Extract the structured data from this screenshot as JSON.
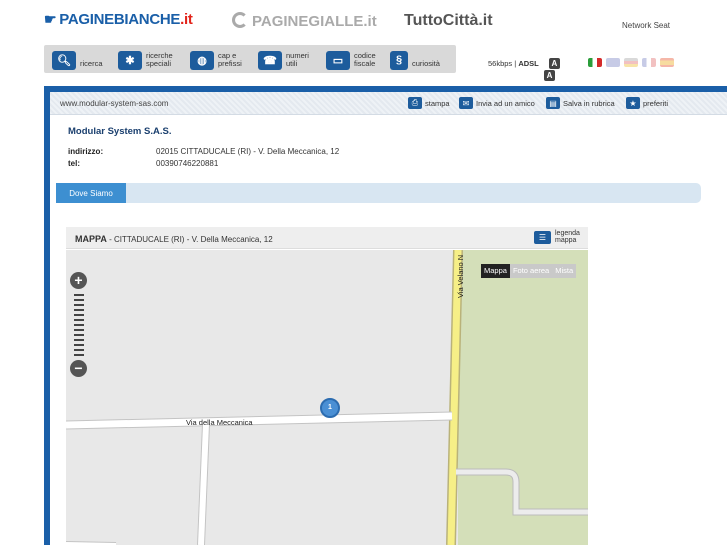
{
  "header": {
    "logo_pb": "PAGINEBIANCHE",
    "logo_pb_suffix": ".it",
    "logo_pg": "PAGINEGIALLE.it",
    "logo_tc": "TuttoCittà.it",
    "network": "Network Seat"
  },
  "toolbar": {
    "items": [
      {
        "label": "ricerca",
        "icon": "search-icon"
      },
      {
        "label": "ricerche speciali",
        "icon": "puzzle-icon"
      },
      {
        "label": "cap e prefissi",
        "icon": "globe-icon"
      },
      {
        "label": "numeri utili",
        "icon": "phone-icon"
      },
      {
        "label": "codice fiscale",
        "icon": "id-card-icon"
      },
      {
        "label": "curiosità",
        "icon": "info-icon"
      }
    ],
    "speed": "56kbps",
    "adsl": "ADSL",
    "font_small": "A",
    "font_large": "A"
  },
  "languages": [
    "it",
    "en",
    "de",
    "fr",
    "es"
  ],
  "page": {
    "url": "www.modular-system-sas.com",
    "actions": {
      "print": "stampa",
      "send": "Invia ad un amico",
      "save": "Salva in rubrica",
      "favorites": "preferiti"
    },
    "company": "Modular System S.A.S.",
    "address_label": "indirizzo:",
    "address": "02015 CITTADUCALE (RI) - V. Della Meccanica, 12",
    "tel_label": "tel:",
    "tel": "00390746220881",
    "tab": "Dove Siamo"
  },
  "map": {
    "title": "MAPPA",
    "subtitle": "CITTADUCALE (RI) - V. Della Meccanica, 12",
    "legend_line1": "legenda",
    "legend_line2": "mappa",
    "types": [
      "Mappa",
      "Foto aerea",
      "Mista"
    ],
    "active_type": "Mappa",
    "street1": "Via della Meccanica",
    "street2": "Via Velano N",
    "marker": "1"
  },
  "colors": {
    "brand_blue": "#1a5fa8",
    "tab_active": "#3d8fd1",
    "map_green": "#d4dfb9"
  }
}
